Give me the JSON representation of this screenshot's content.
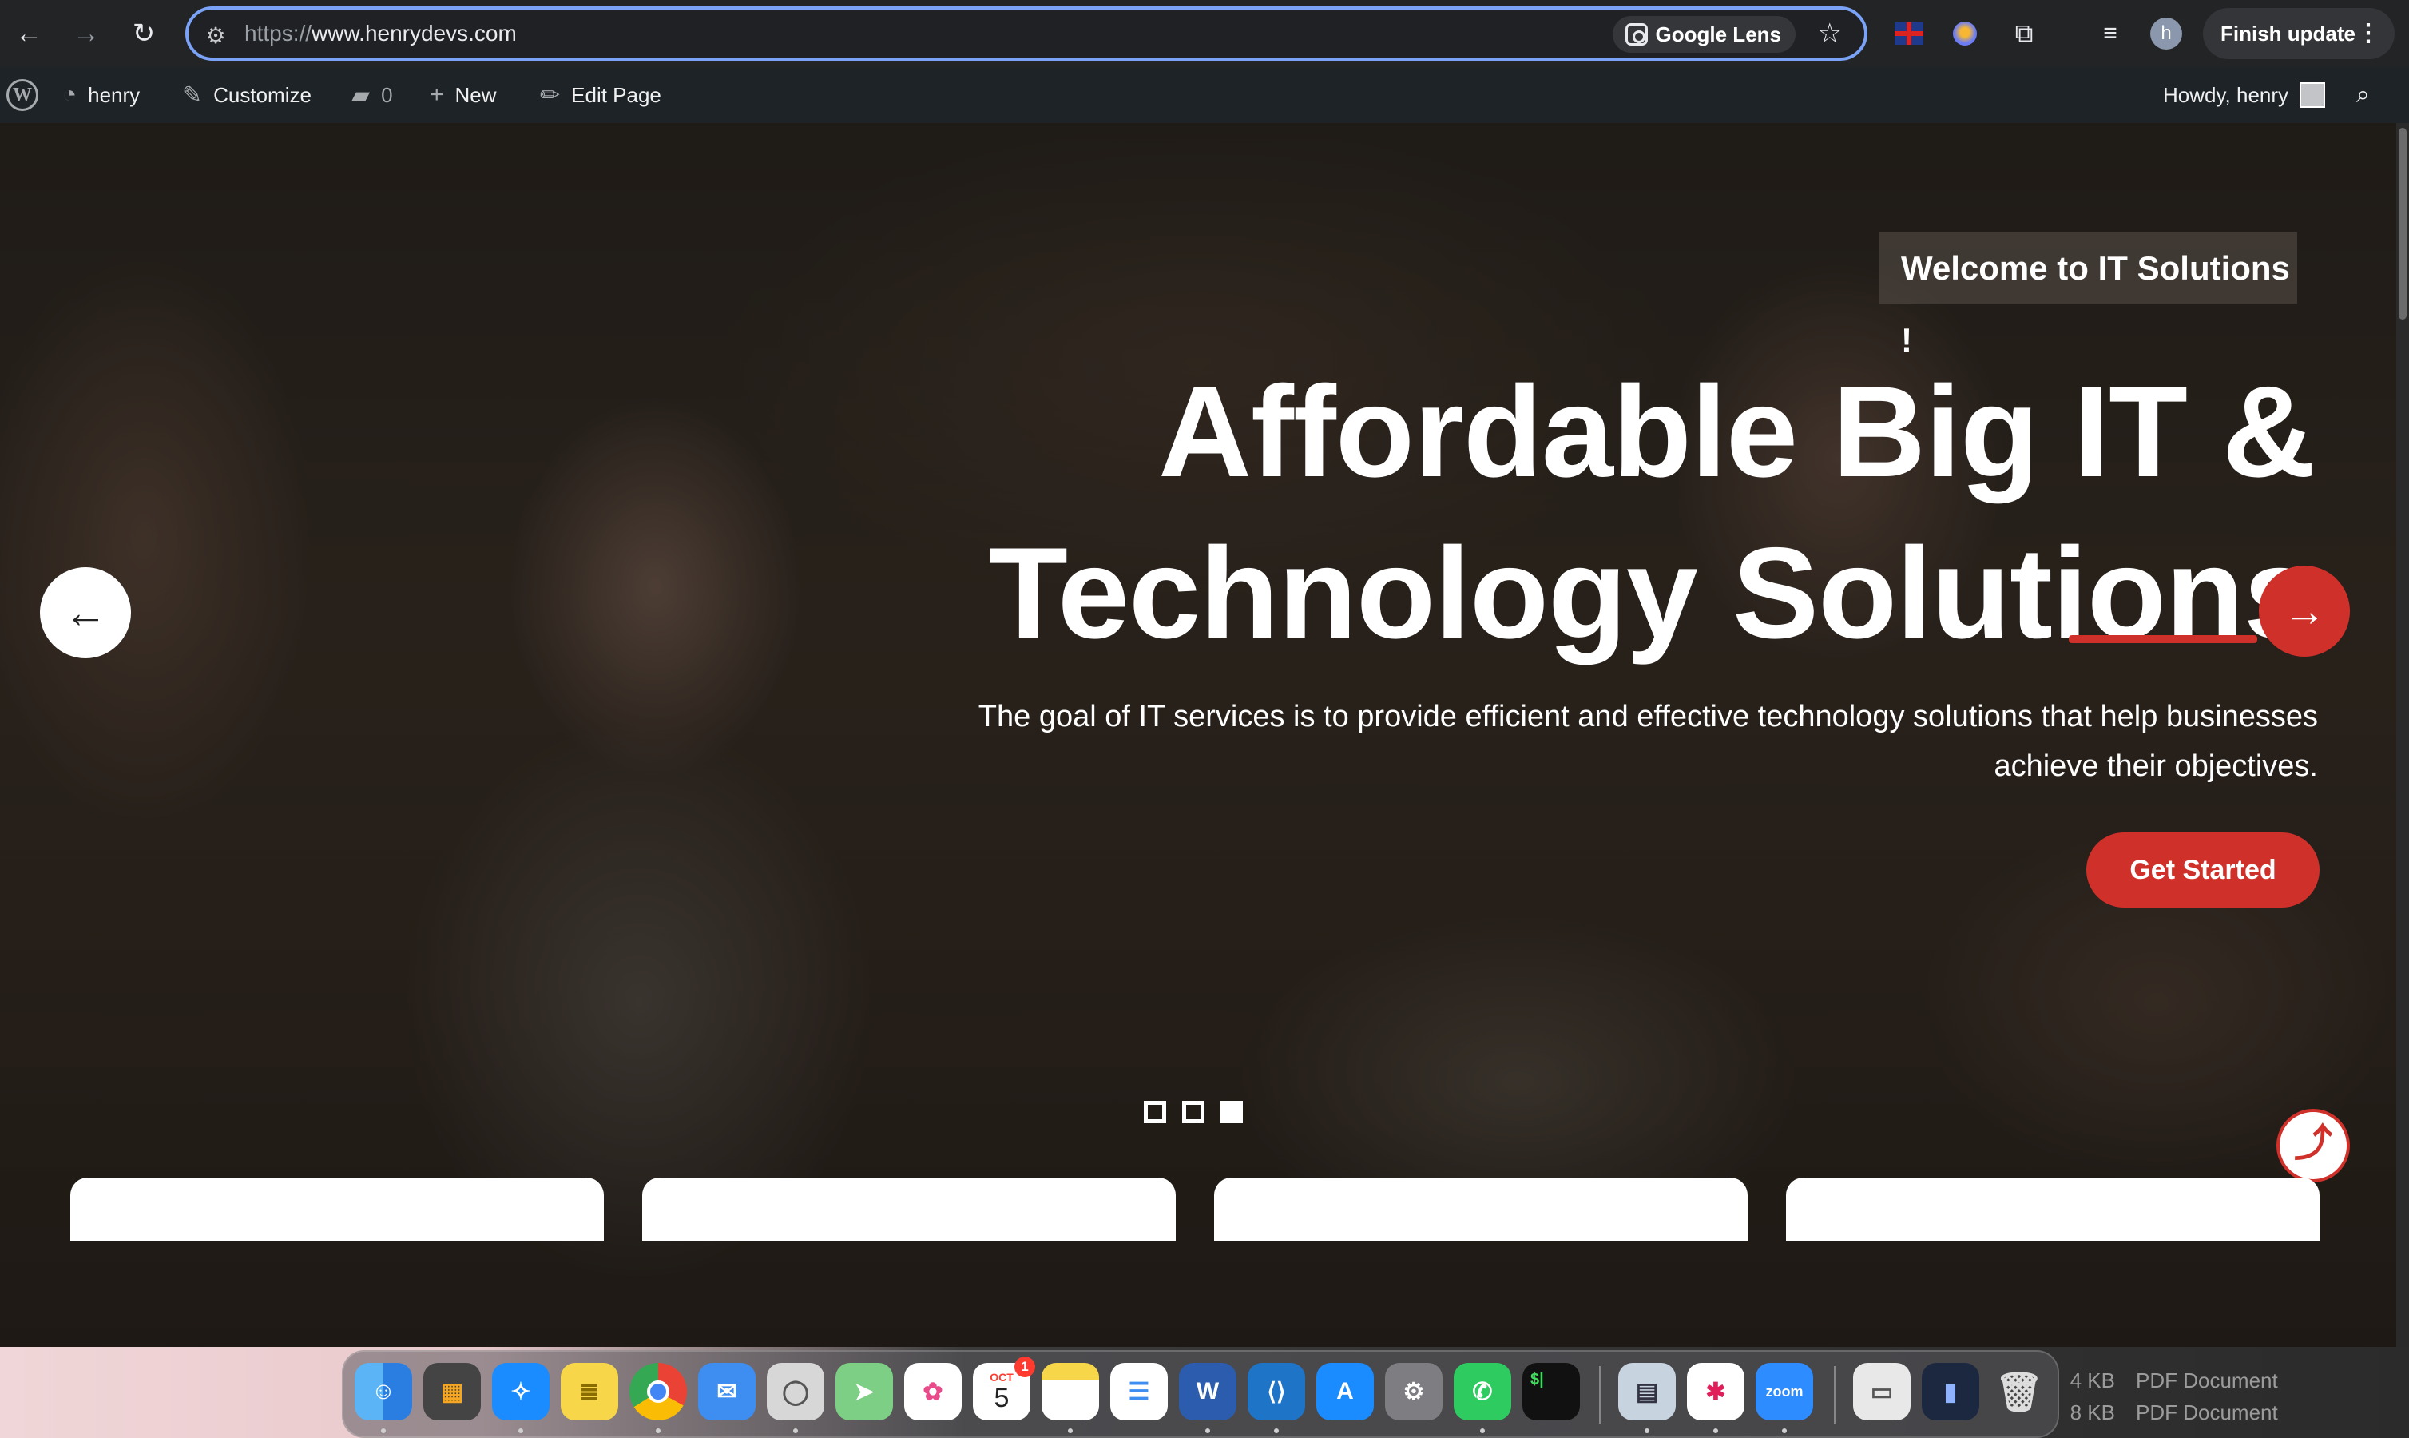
{
  "browser": {
    "url_scheme": "https://",
    "url_host": "www.henrydevs.com",
    "lens_label": "Google Lens",
    "profile_initial": "h",
    "finish_update_label": "Finish update"
  },
  "adminbar": {
    "site_name": "henry",
    "customize_label": "Customize",
    "comments_count": "0",
    "new_label": "New",
    "edit_page_label": "Edit Page",
    "howdy_label": "Howdy, henry"
  },
  "hero": {
    "welcome": "Welcome to IT Solutions !",
    "headline_line1": "Affordable Big IT &",
    "headline_line2": "Technology Solutions",
    "subtext": "The goal of IT services is to provide efficient and effective technology solutions that help businesses achieve their objectives.",
    "cta_label": "Get Started",
    "slides_total": 3,
    "active_slide": 3
  },
  "finder": {
    "files": [
      {
        "size": "4 KB",
        "kind": "PDF Document"
      },
      {
        "size": "8 KB",
        "kind": "PDF Document"
      }
    ]
  },
  "dock": {
    "calendar_month": "OCT",
    "calendar_day": "5",
    "calendar_badge": "1",
    "zoom_label": "zoom",
    "terminal_label": "$|"
  },
  "colors": {
    "accent_red": "#d0302a",
    "omnibox_border": "#7aa2f7",
    "adminbar_bg": "#1d2327"
  },
  "icons": {
    "back": "arrow-left-icon",
    "forward": "arrow-right-icon",
    "reload": "reload-icon",
    "site_settings": "tune-icon",
    "bookmark": "star-icon",
    "extensions": "puzzle-icon",
    "media": "media-queue-icon",
    "menu": "kebab-menu-icon",
    "wordpress": "wordpress-logo-icon",
    "dashboard": "dashboard-gauge-icon",
    "customize": "paintbrush-icon",
    "comments": "speech-bubble-icon",
    "new": "plus-icon",
    "edit": "pencil-icon",
    "search": "search-icon",
    "slider_prev": "arrow-left-icon",
    "slider_next": "arrow-right-icon",
    "back_to_top": "arrow-up-icon"
  }
}
